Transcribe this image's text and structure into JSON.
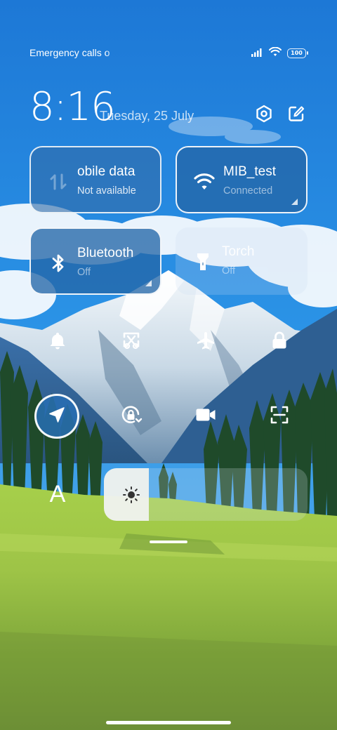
{
  "status_bar": {
    "carrier_text": "Emergency calls o",
    "battery_level": "100",
    "icons": [
      "signal-icon",
      "wifi-icon",
      "battery-icon"
    ]
  },
  "header": {
    "time": "8:16",
    "date": "Tuesday, 25 July",
    "settings_icon": "hexagon-settings-icon",
    "edit_icon": "edit-icon"
  },
  "tiles": [
    {
      "id": "mobile-data",
      "label": "Mobile data",
      "visible_label": "obile data",
      "status": "Not available",
      "state": "unavailable",
      "icon": "mobile-data-icon"
    },
    {
      "id": "wifi",
      "label": "MIB_test",
      "status": "Connected",
      "state": "active",
      "icon": "wifi-icon"
    },
    {
      "id": "bluetooth",
      "label": "Bluetooth",
      "status": "Off",
      "state": "active",
      "icon": "bluetooth-icon"
    },
    {
      "id": "torch",
      "label": "Torch",
      "status": "Off",
      "state": "inactive",
      "icon": "torch-icon"
    }
  ],
  "toggles_row1": [
    {
      "id": "silent",
      "icon": "bell-icon",
      "state": "off"
    },
    {
      "id": "screenshot",
      "icon": "screenshot-icon",
      "state": "off"
    },
    {
      "id": "airplane",
      "icon": "airplane-icon",
      "state": "off"
    },
    {
      "id": "lock",
      "icon": "lock-icon",
      "state": "off"
    }
  ],
  "toggles_row2": [
    {
      "id": "location",
      "icon": "location-arrow-icon",
      "state": "on"
    },
    {
      "id": "rotation-lock",
      "icon": "rotation-lock-icon",
      "state": "off"
    },
    {
      "id": "screen-recorder",
      "icon": "video-camera-icon",
      "state": "off"
    },
    {
      "id": "scanner",
      "icon": "scan-icon",
      "state": "off"
    }
  ],
  "font_size_button": "A",
  "brightness": {
    "level": 0.22,
    "icon": "sun-icon"
  },
  "colors": {
    "active_tile": "#2466a8",
    "sky_top": "#1f7fd9",
    "meadow": "#8fbf3a"
  }
}
